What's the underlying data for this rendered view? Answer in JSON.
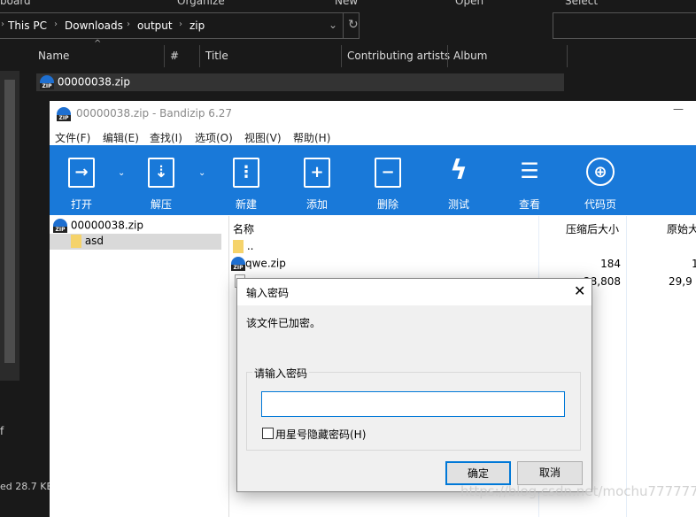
{
  "explorer": {
    "ribbon": [
      "board",
      "Organize",
      "New",
      "Open",
      "Select"
    ],
    "breadcrumb": [
      "This PC",
      "Downloads",
      "output",
      "zip"
    ],
    "columns": [
      "Name",
      "#",
      "Title",
      "Contributing artists",
      "Album"
    ],
    "files": [
      {
        "name": "00000038.zip"
      }
    ],
    "status": "ed  28.7 KB",
    "nav_partial": "f"
  },
  "bandizip": {
    "title": "00000038.zip - Bandizip 6.27",
    "menu": [
      "文件(F)",
      "编辑(E)",
      "查找(I)",
      "选项(O)",
      "视图(V)",
      "帮助(H)"
    ],
    "toolbar": [
      {
        "label": "打开",
        "icon": "open-icon"
      },
      {
        "label": "解压",
        "icon": "extract-icon"
      },
      {
        "label": "新建",
        "icon": "new-archive-icon"
      },
      {
        "label": "添加",
        "icon": "add-icon"
      },
      {
        "label": "删除",
        "icon": "delete-icon"
      },
      {
        "label": "测试",
        "icon": "test-icon"
      },
      {
        "label": "查看",
        "icon": "view-icon"
      },
      {
        "label": "代码页",
        "icon": "codepage-icon"
      }
    ],
    "toolbar_color": "#1979d9",
    "tree": {
      "root": "00000038.zip",
      "child": "asd"
    },
    "list_columns": [
      "名称",
      "压缩后大小",
      "原始大"
    ],
    "rows": [
      {
        "name": "..",
        "packed": "",
        "orig": ""
      },
      {
        "name": "qwe.zip",
        "packed": "184",
        "orig": "1"
      },
      {
        "name": "",
        "packed": "28,808",
        "orig": "29,9"
      }
    ]
  },
  "dialog": {
    "title": "输入密码",
    "message": "该文件已加密。",
    "group_label": "请输入密码",
    "password_value": "",
    "checkbox_label": "用星号隐藏密码(H)",
    "checkbox_checked": false,
    "ok": "确定",
    "cancel": "取消"
  },
  "watermark": "https://blog.csdn.net/mochu7777777"
}
